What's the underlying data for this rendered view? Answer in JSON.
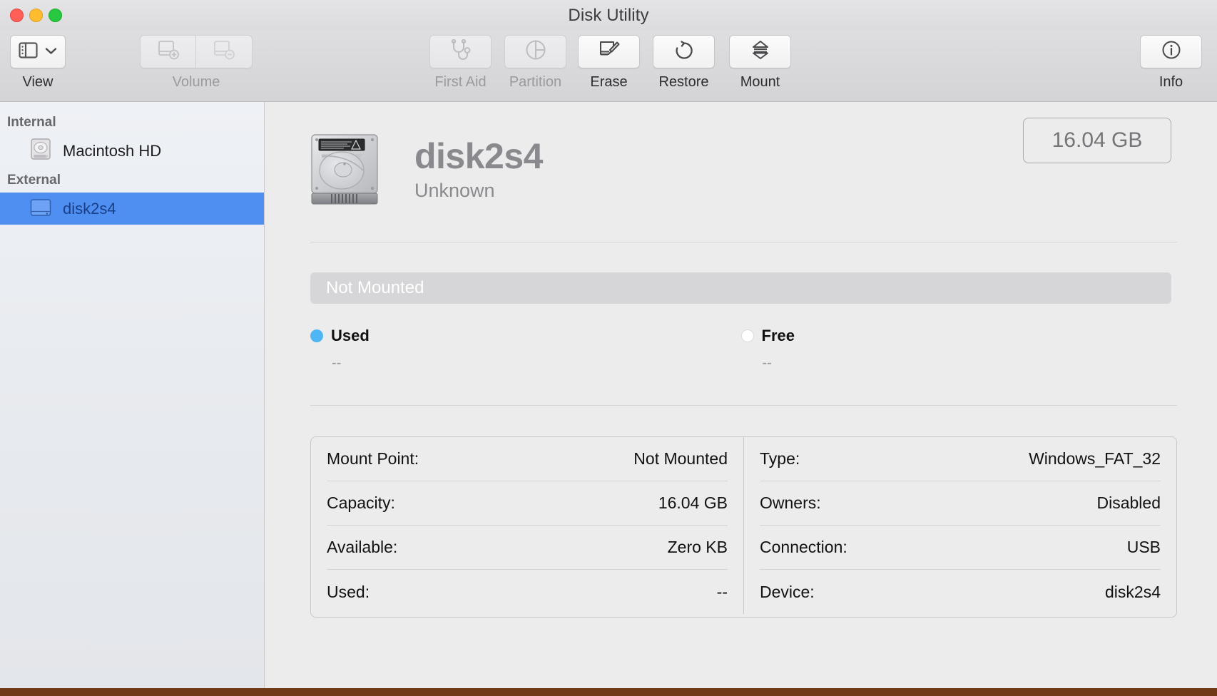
{
  "window": {
    "title": "Disk Utility",
    "traffic_lights": [
      "close-button",
      "minimize-button",
      "zoom-button"
    ]
  },
  "toolbar": {
    "view": {
      "label": "View",
      "icon": "sidebar-icon",
      "chevron": "chevron-down-icon",
      "enabled": true
    },
    "volume": {
      "label": "Volume",
      "add": {
        "icon": "volume-add-icon",
        "enabled": false
      },
      "remove": {
        "icon": "volume-remove-icon",
        "enabled": false
      }
    },
    "items": [
      {
        "label": "First Aid",
        "icon": "stethoscope-icon",
        "enabled": false
      },
      {
        "label": "Partition",
        "icon": "pie-chart-icon",
        "enabled": false
      },
      {
        "label": "Erase",
        "icon": "erase-icon",
        "enabled": true
      },
      {
        "label": "Restore",
        "icon": "restore-arrow-icon",
        "enabled": true
      },
      {
        "label": "Mount",
        "icon": "mount-eject-icon",
        "enabled": true
      }
    ],
    "info": {
      "label": "Info",
      "icon": "info-circle-icon",
      "enabled": true
    }
  },
  "sidebar": {
    "groups": [
      {
        "header": "Internal",
        "items": [
          {
            "label": "Macintosh HD",
            "icon": "internal-disk-icon",
            "selected": false
          }
        ]
      },
      {
        "header": "External",
        "items": [
          {
            "label": "disk2s4",
            "icon": "external-disk-icon",
            "selected": true
          }
        ]
      }
    ]
  },
  "main": {
    "device_icon": "hard-drive-icon",
    "device_name": "disk2s4",
    "device_subtitle": "Unknown",
    "capacity_badge": "16.04 GB",
    "usage_bar": {
      "status_text": "Not Mounted",
      "fill_percent": 0
    },
    "legend": [
      {
        "name": "Used",
        "value": "--",
        "color": "#4fb6f4"
      },
      {
        "name": "Free",
        "value": "--",
        "color": "#ffffff"
      }
    ],
    "details": {
      "left": [
        {
          "key": "Mount Point:",
          "value": "Not Mounted"
        },
        {
          "key": "Capacity:",
          "value": "16.04 GB"
        },
        {
          "key": "Available:",
          "value": "Zero KB"
        },
        {
          "key": "Used:",
          "value": "--"
        }
      ],
      "right": [
        {
          "key": "Type:",
          "value": "Windows_FAT_32"
        },
        {
          "key": "Owners:",
          "value": "Disabled"
        },
        {
          "key": "Connection:",
          "value": "USB"
        },
        {
          "key": "Device:",
          "value": "disk2s4"
        }
      ]
    }
  },
  "colors": {
    "selection_blue": "#4f8ff2",
    "used_blue": "#4fb6f4",
    "window_bg": "#ececec",
    "sidebar_bg": "#eef1f5"
  }
}
